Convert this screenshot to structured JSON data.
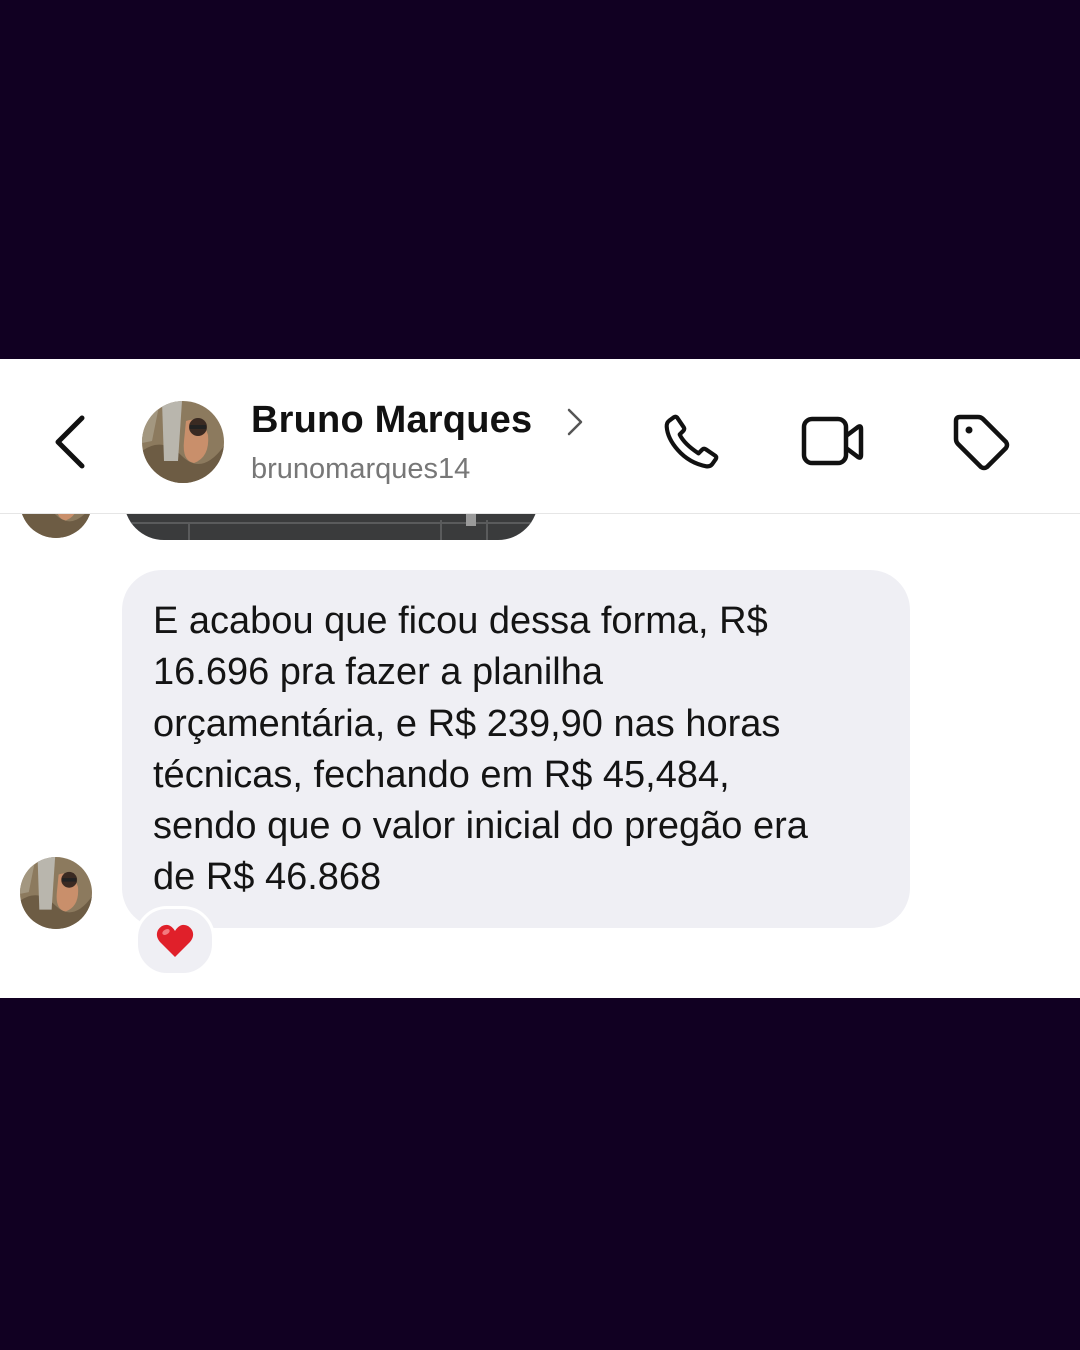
{
  "header": {
    "back_icon": "chevron-left-icon",
    "name": "Bruno Marques",
    "handle": "brunomarques14",
    "actions": [
      "phone-icon",
      "video-camera-icon",
      "tag-icon"
    ]
  },
  "messages": [
    {
      "type": "image",
      "partial": true
    },
    {
      "type": "text",
      "text": "E acabou que ficou dessa forma, R$\n16.696 pra fazer a planilha\norçamentária, e R$ 239,90 nas horas\ntécnicas, fechando em R$ 45,484,\nsendo que o valor inicial do pregão era\nde R$ 46.868",
      "reaction": "❤️"
    }
  ],
  "colors": {
    "frame_background": "#110022",
    "bubble_background": "#efeff4",
    "text": "#141414",
    "handle_text": "#777777",
    "reaction_heart": "#e0202a"
  }
}
